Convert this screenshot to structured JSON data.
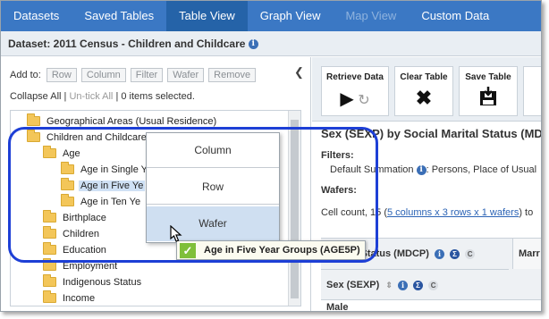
{
  "nav": {
    "tabs": [
      {
        "label": "Datasets"
      },
      {
        "label": "Saved Tables"
      },
      {
        "label": "Table View"
      },
      {
        "label": "Graph View"
      },
      {
        "label": "Map View"
      },
      {
        "label": "Custom Data"
      }
    ],
    "active": "Table View",
    "disabled": "Map View"
  },
  "dataset": {
    "title": "Dataset: 2011 Census - Children and Childcare",
    "info_icon": "info-icon"
  },
  "left": {
    "add_to_label": "Add to:",
    "add_buttons": [
      "Row",
      "Column",
      "Filter",
      "Wafer",
      "Remove"
    ],
    "collapse_all": "Collapse All",
    "untick_all": "Un-tick All",
    "selected_text": "0 items selected.",
    "tree": [
      {
        "label": "Geographical Areas (Usual Residence)",
        "level": 0
      },
      {
        "label": "Children and Childcare",
        "level": 0
      },
      {
        "label": "Age",
        "level": 1
      },
      {
        "label": "Age in Single Y",
        "level": 2
      },
      {
        "label": "Age in Five Ye",
        "level": 2,
        "selected": true
      },
      {
        "label": "Age in Ten Ye",
        "level": 2
      },
      {
        "label": "Birthplace",
        "level": 1
      },
      {
        "label": "Children",
        "level": 1
      },
      {
        "label": "Education",
        "level": 1
      },
      {
        "label": "Employment",
        "level": 1
      },
      {
        "label": "Indigenous Status",
        "level": 1
      },
      {
        "label": "Income",
        "level": 1
      }
    ]
  },
  "context_menu": {
    "items": [
      "Column",
      "Row",
      "Wafer"
    ],
    "hover": "Wafer"
  },
  "drag_tooltip": {
    "text": "Age in Five Year Groups (AGE5P)",
    "icon": "check-icon"
  },
  "toolbar": {
    "tools": [
      {
        "label": "Retrieve Data",
        "icon": "play-refresh-icon"
      },
      {
        "label": "Clear Table",
        "icon": "clear-x-icon"
      },
      {
        "label": "Save Table",
        "icon": "save-icon"
      }
    ]
  },
  "table": {
    "title": "Sex (SEXP) by Social Marital Status (MDC",
    "filters_label": "Filters:",
    "filters_value_prefix": "Default Summation",
    "filters_value_suffix": ": Persons, Place of Usual",
    "wafers_label": "Wafers:",
    "cell_count_prefix": "Cell count, 15 (",
    "cell_count_link": "5 columns x 3 rows x 1 wafers",
    "cell_count_suffix": ") to",
    "col_header": "Marital Status (MDCP)",
    "col2_header": "Marr",
    "row_header": "Sex (SEXP)",
    "first_row": "Male"
  },
  "colors": {
    "nav_bg": "#3b78c4",
    "nav_active": "#2563a8",
    "focus_ring": "#1d3fd6",
    "folder": "#f3c659",
    "check": "#7fbf3a"
  }
}
